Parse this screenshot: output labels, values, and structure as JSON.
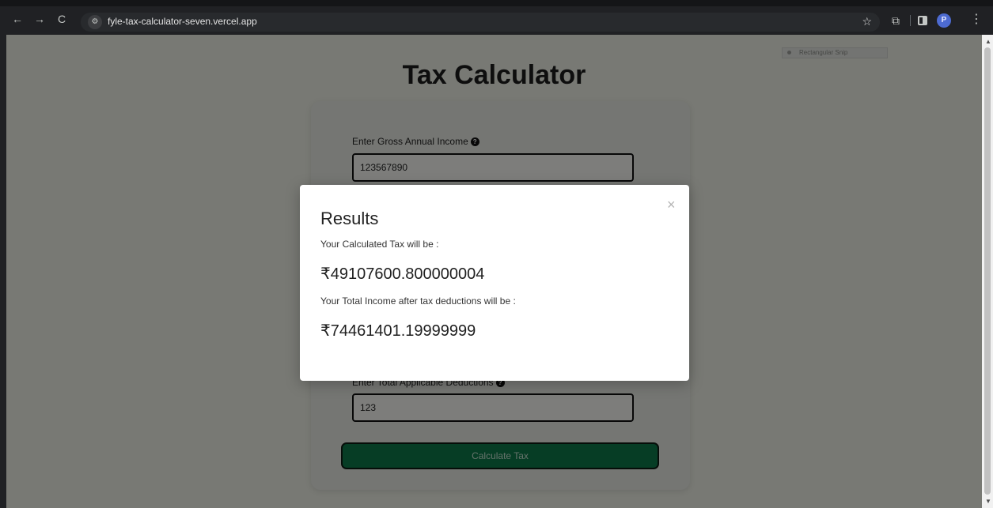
{
  "browser": {
    "url": "fyle-tax-calculator-seven.vercel.app",
    "avatar_letter": "P",
    "icons": {
      "back": "arrow-left-icon",
      "forward": "arrow-right-icon",
      "reload": "reload-icon",
      "site_info": "tune-icon",
      "bookmark": "star-icon",
      "extensions": "puzzle-icon",
      "side_panel": "side-panel-icon",
      "menu": "more-vert-icon"
    }
  },
  "snip_tool": {
    "label": "Rectangular Snip"
  },
  "page": {
    "title": "Tax Calculator",
    "fields": [
      {
        "label": "Enter Gross Annual Income",
        "value": "123567890"
      },
      {
        "label": "Enter Total Applicable Deductions",
        "value": "123"
      }
    ],
    "help_icon_glyph": "?",
    "calculate_button": "Calculate Tax"
  },
  "modal": {
    "title": "Results",
    "close_glyph": "×",
    "tax_label": "Your Calculated Tax will be :",
    "tax_value": "₹49107600.800000004",
    "income_label": "Your Total Income after tax deductions will be :",
    "income_value": "₹74461401.19999999"
  },
  "colors": {
    "button": "#0d7a4a",
    "page_bg": "#f0f2e8",
    "card_bg": "#eaece6"
  }
}
